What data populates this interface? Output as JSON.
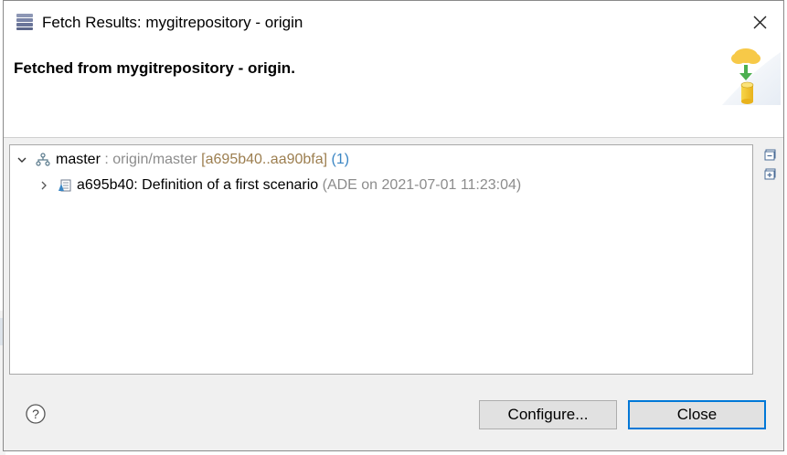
{
  "window": {
    "title": "Fetch Results: mygitrepository - origin",
    "close_icon": "close-icon",
    "app_icon": "fetch-results-icon"
  },
  "header": {
    "title": "Fetched from mygitrepository - origin.",
    "illustration_icon": "cloud-fetch-to-repository-icon"
  },
  "tree": {
    "branch": {
      "name": "master",
      "separator_remote": " : origin/master ",
      "range": "[a695b40..aa90bfa]",
      "count": "(1)",
      "icon": "branch-icon",
      "expanded": true
    },
    "commit": {
      "label": "a695b40: Definition of a first scenario",
      "meta": "(ADE on 2021-07-01 11:23:04)",
      "icon": "commit-icon",
      "expanded": false
    }
  },
  "side_tools": {
    "collapse_icon": "collapse-all-icon",
    "expand_icon": "expand-all-icon"
  },
  "footer": {
    "help_icon": "help-icon",
    "configure_label": "Configure...",
    "close_label": "Close"
  },
  "colors": {
    "accent": "#0078d7",
    "remote_text": "#8c8c8c",
    "range_text": "#9c7e4f",
    "count_text": "#3b86c4"
  }
}
